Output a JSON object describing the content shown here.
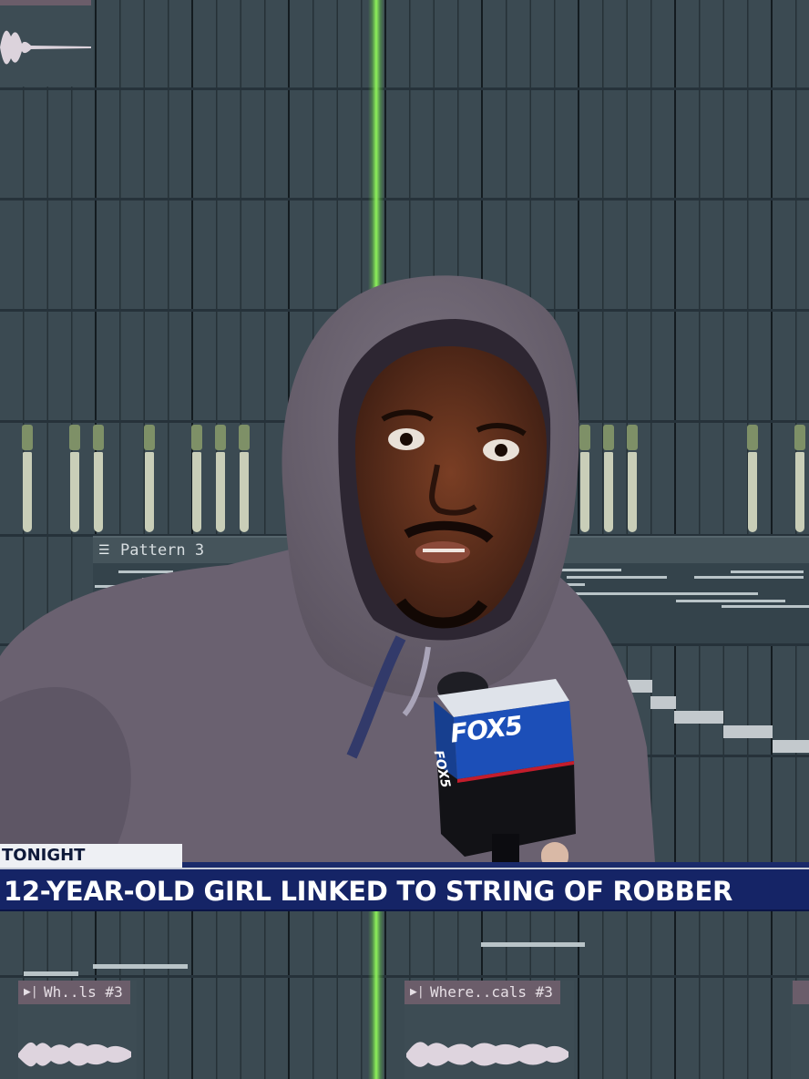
{
  "patterns": {
    "pattern_3": {
      "label": "Pattern 3",
      "icon": "pattern-icon"
    }
  },
  "audio_clips": [
    {
      "label": "Wh..ls #3",
      "icon": "audio-clip-arrow-icon"
    },
    {
      "label": "Where..cals #3",
      "icon": "audio-clip-arrow-icon"
    }
  ],
  "news": {
    "tag": "TONIGHT",
    "headline": "12-YEAR-OLD GIRL LINKED TO STRING OF ROBBER",
    "mic_logo": "FOX5",
    "mic_side_logo": "FOX5"
  },
  "colors": {
    "playhead": "#8ef25a",
    "grid_bg": "#3b4a52",
    "ticker_bg": "#152466",
    "hoodie": "#6d6470"
  }
}
